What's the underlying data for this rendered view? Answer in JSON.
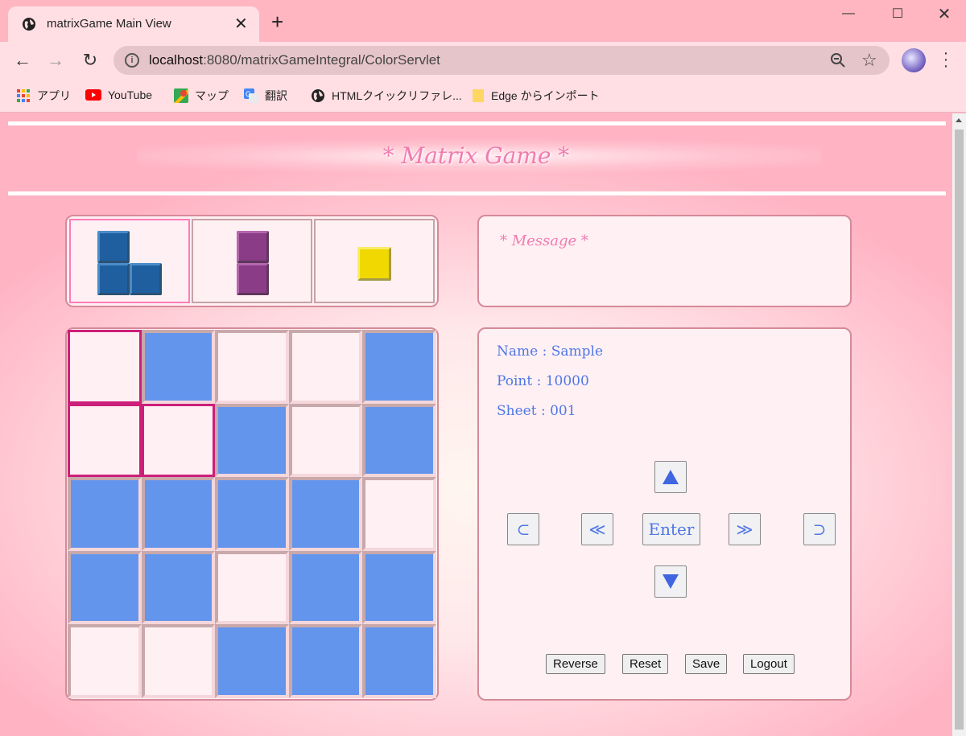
{
  "browser": {
    "tab_title": "matrixGame Main View",
    "url_host": "localhost",
    "url_rest": ":8080/matrixGameIntegral/ColorServlet",
    "info_symbol": "i",
    "bookmarks": [
      "アプリ",
      "YouTube",
      "マップ",
      "翻訳",
      "HTMLクイックリファレ...",
      "Edge からインポート"
    ]
  },
  "page": {
    "title": "* Matrix Game *",
    "message_title": "* Message *",
    "pieces": [
      {
        "name": "L-piece",
        "color": "#1f5fa0"
      },
      {
        "name": "bar-piece",
        "color": "#8a3d86"
      },
      {
        "name": "square-piece",
        "color": "#f0d800"
      }
    ],
    "board": [
      [
        0,
        1,
        0,
        0,
        1
      ],
      [
        0,
        0,
        1,
        0,
        1
      ],
      [
        1,
        1,
        1,
        1,
        0
      ],
      [
        1,
        1,
        0,
        1,
        1
      ],
      [
        0,
        0,
        1,
        1,
        1
      ]
    ],
    "board_selected": [
      [
        0,
        0
      ],
      [
        1,
        0
      ],
      [
        1,
        1
      ]
    ],
    "info": {
      "name": "Name : Sample",
      "point": "Point : 10000",
      "sheet": "Sheet : 001"
    },
    "controls": {
      "rotate_left": "⊂",
      "prev": "≪",
      "enter": "Enter",
      "next": "≫",
      "rotate_right": "⊃"
    },
    "buttons": {
      "reverse": "Reverse",
      "reset": "Reset",
      "save": "Save",
      "logout": "Logout"
    },
    "colors": {
      "filled": "#6495ed",
      "empty": "#fff0f3",
      "selected_border": "#cc1f7a",
      "accent": "#f07cb0"
    }
  }
}
